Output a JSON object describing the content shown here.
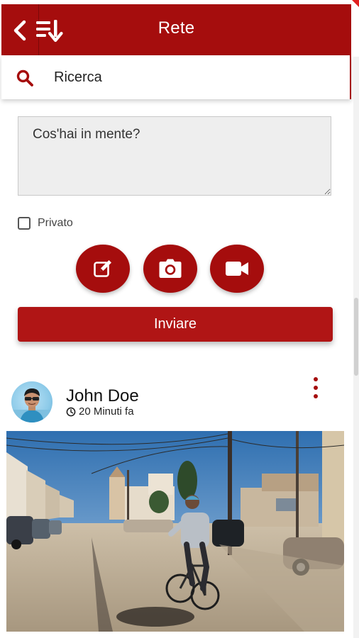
{
  "header": {
    "title": "Rete",
    "back_icon": "chevron-left-icon",
    "sort_icon": "sort-list-down-icon"
  },
  "search": {
    "placeholder": "Ricerca",
    "icon": "search-icon"
  },
  "composer": {
    "placeholder": "Cos'hai in mente?",
    "private_label": "Privato",
    "private_checked": false,
    "actions": [
      {
        "icon": "edit-icon"
      },
      {
        "icon": "camera-icon"
      },
      {
        "icon": "video-icon"
      }
    ],
    "send_label": "Inviare"
  },
  "post": {
    "author": "John Doe",
    "time": "20 Minuti fa",
    "menu_icon": "more-vertical-icon"
  },
  "colors": {
    "brand": "#a50d0d",
    "button": "#b01515"
  }
}
